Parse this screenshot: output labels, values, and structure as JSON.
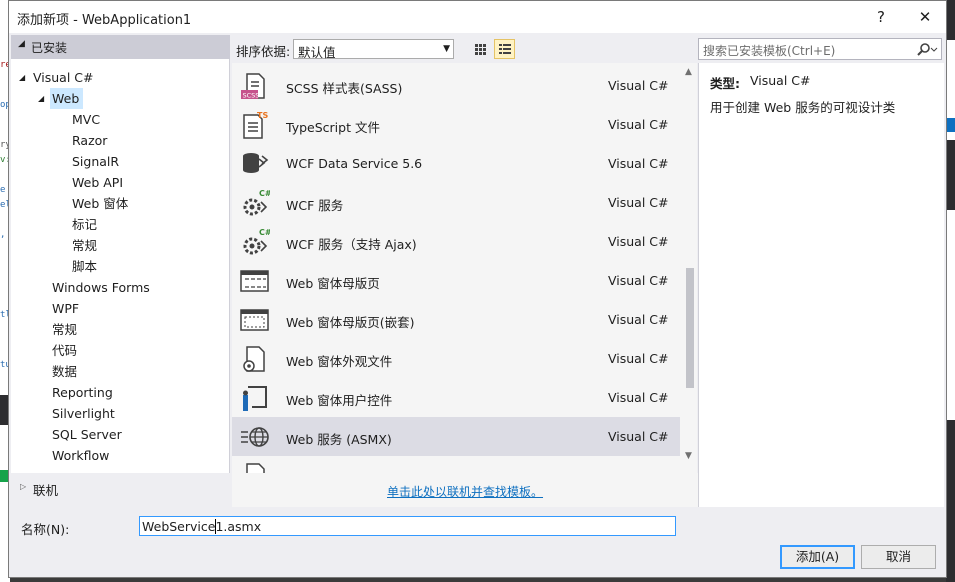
{
  "dialog": {
    "title": "添加新项 - WebApplication1",
    "help_glyph": "?",
    "close_glyph": "✕"
  },
  "tree": {
    "header": "已安装",
    "items": [
      {
        "label": "Visual C#",
        "level": 0,
        "expanded": true
      },
      {
        "label": "Web",
        "level": 1,
        "expanded": true,
        "selected": true
      },
      {
        "label": "MVC",
        "level": 2
      },
      {
        "label": "Razor",
        "level": 2
      },
      {
        "label": "SignalR",
        "level": 2
      },
      {
        "label": "Web API",
        "level": 2
      },
      {
        "label": "Web 窗体",
        "level": 2
      },
      {
        "label": "标记",
        "level": 2
      },
      {
        "label": "常规",
        "level": 2
      },
      {
        "label": "脚本",
        "level": 2
      },
      {
        "label": "Windows Forms",
        "level": 1
      },
      {
        "label": "WPF",
        "level": 1
      },
      {
        "label": "常规",
        "level": 1
      },
      {
        "label": "代码",
        "level": 1
      },
      {
        "label": "数据",
        "level": 1
      },
      {
        "label": "Reporting",
        "level": 1
      },
      {
        "label": "Silverlight",
        "level": 1
      },
      {
        "label": "SQL Server",
        "level": 1
      },
      {
        "label": "Workflow",
        "level": 1
      }
    ],
    "online": "联机"
  },
  "sort": {
    "label": "排序依据:",
    "value": "默认值"
  },
  "templates": [
    {
      "name": "SCSS 样式表(SASS)",
      "lang": "Visual C#",
      "icon": "scss-file-icon"
    },
    {
      "name": "TypeScript 文件",
      "lang": "Visual C#",
      "icon": "typescript-file-icon"
    },
    {
      "name": "WCF Data Service 5.6",
      "lang": "Visual C#",
      "icon": "wcf-data-service-icon"
    },
    {
      "name": "WCF 服务",
      "lang": "Visual C#",
      "icon": "wcf-service-icon"
    },
    {
      "name": "WCF 服务（支持 Ajax)",
      "lang": "Visual C#",
      "icon": "wcf-ajax-service-icon"
    },
    {
      "name": "Web 窗体母版页",
      "lang": "Visual C#",
      "icon": "master-page-icon"
    },
    {
      "name": "Web 窗体母版页(嵌套)",
      "lang": "Visual C#",
      "icon": "nested-master-page-icon"
    },
    {
      "name": "Web 窗体外观文件",
      "lang": "Visual C#",
      "icon": "skin-file-icon"
    },
    {
      "name": "Web 窗体用户控件",
      "lang": "Visual C#",
      "icon": "user-control-icon"
    },
    {
      "name": "Web 服务 (ASMX)",
      "lang": "Visual C#",
      "icon": "web-service-icon",
      "selected": true
    }
  ],
  "online_link": "单击此处以联机并查找模板。",
  "search": {
    "placeholder": "搜索已安装模板(Ctrl+E)"
  },
  "details": {
    "type_label": "类型:",
    "type_value": "Visual C#",
    "description": "用于创建 Web 服务的可视设计类"
  },
  "name_field": {
    "label": "名称(N):",
    "value": "WebService1.asmx"
  },
  "buttons": {
    "add": "添加(A)",
    "cancel": "取消"
  },
  "colors": {
    "accent": "#3399ff",
    "selection": "#cce8ff",
    "link": "#0e70c0"
  }
}
